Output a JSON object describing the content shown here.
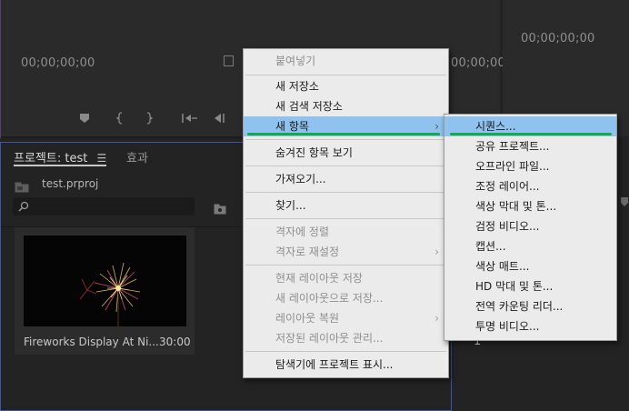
{
  "source_monitor": {
    "timecode_left": "00;00;00;00",
    "timecode_right": "00;00;00;00"
  },
  "right_monitor": {
    "timecode": "00;00;00;00",
    "playhead_marker": "1"
  },
  "project_panel": {
    "tab_project": "프로젝트: test",
    "tab_effects": "효과",
    "project_file": "test.prproj",
    "clip": {
      "name": "Fireworks Display At Ni...",
      "duration": "30:00"
    }
  },
  "context_menu": {
    "items": [
      {
        "label": "붙여넣기"
      },
      {
        "label": "새 저장소"
      },
      {
        "label": "새 검색 저장소"
      },
      {
        "label": "새 항목"
      },
      {
        "label": "숨겨진 항목 보기"
      },
      {
        "label": "가져오기..."
      },
      {
        "label": "찾기..."
      },
      {
        "label": "격자에 정렬"
      },
      {
        "label": "격자로 재설정"
      },
      {
        "label": "현재 레이아웃 저장"
      },
      {
        "label": "새 레이아웃으로 저장..."
      },
      {
        "label": "레이아웃 복원"
      },
      {
        "label": "저장된 레이아웃 관리..."
      },
      {
        "label": "탐색기에 프로젝트 표시..."
      }
    ],
    "arrow_glyph": "›"
  },
  "submenu": {
    "items": [
      {
        "label": "시퀀스..."
      },
      {
        "label": "공유 프로젝트..."
      },
      {
        "label": "오프라인 파일..."
      },
      {
        "label": "조정 레이어..."
      },
      {
        "label": "색상 막대 및 톤..."
      },
      {
        "label": "검정 비디오..."
      },
      {
        "label": "캡션..."
      },
      {
        "label": "색상 매트..."
      },
      {
        "label": "HD 막대 및 톤..."
      },
      {
        "label": "전역 카운팅 리더..."
      },
      {
        "label": "투명 비디오..."
      }
    ]
  },
  "colors": {
    "highlight": "#8fc2ef",
    "green_underline": "#17a84a",
    "panel_focus_border": "#3f55a8"
  }
}
